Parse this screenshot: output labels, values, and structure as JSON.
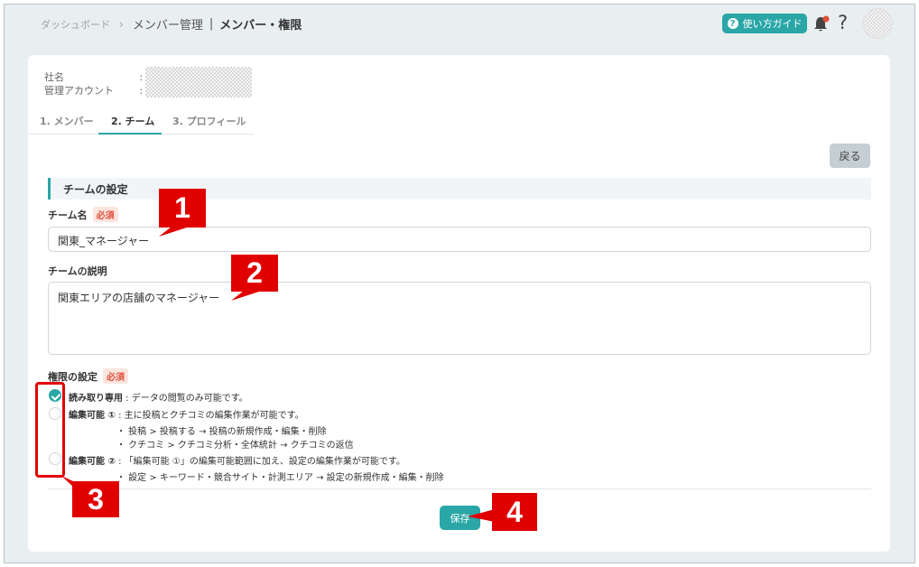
{
  "header": {
    "breadcrumb": [
      "ダッシュボード",
      "メンバー管理",
      "メンバー・権限"
    ],
    "sep_arrow": "›",
    "sep_bar": "|",
    "guide_button": "使い方ガイド",
    "guide_icon": "?",
    "help_icon": "?"
  },
  "meta": {
    "company_label": "社名",
    "account_label": "管理アカウント",
    "colon": ":"
  },
  "tabs": [
    "1. メンバー",
    "2. チーム",
    "3. プロフィール"
  ],
  "back_button": "戻る",
  "section_title": "チームの設定",
  "team_name": {
    "label": "チーム名",
    "required": "必須",
    "value": "関東_マネージャー"
  },
  "team_desc": {
    "label": "チームの説明",
    "value": "関東エリアの店舗のマネージャー"
  },
  "permissions": {
    "label": "権限の設定",
    "required": "必須",
    "options": [
      {
        "title": "読み取り専用",
        "desc": " : データの閲覧のみ可能です。",
        "checked": true
      },
      {
        "title": "編集可能 ①",
        "desc": " : 主に投稿とクチコミの編集作業が可能です。",
        "checked": false,
        "sub": [
          "・ 投稿 > 投稿する → 投稿の新規作成・編集・削除",
          "・ クチコミ > クチコミ分析・全体統計 → クチコミの返信"
        ]
      },
      {
        "title": "編集可能 ②",
        "desc": " : 「編集可能 ①」の編集可能範囲に加え、設定の編集作業が可能です。",
        "checked": false,
        "sub": [
          "・ 設定 > キーワード・競合サイト・計測エリア → 設定の新規作成・編集・削除"
        ]
      }
    ]
  },
  "save_button": "保存",
  "callouts": [
    "1",
    "2",
    "3",
    "4"
  ],
  "colors": {
    "accent": "#2aa6a6",
    "annotation": "#e10000",
    "required": "#e0503a"
  }
}
